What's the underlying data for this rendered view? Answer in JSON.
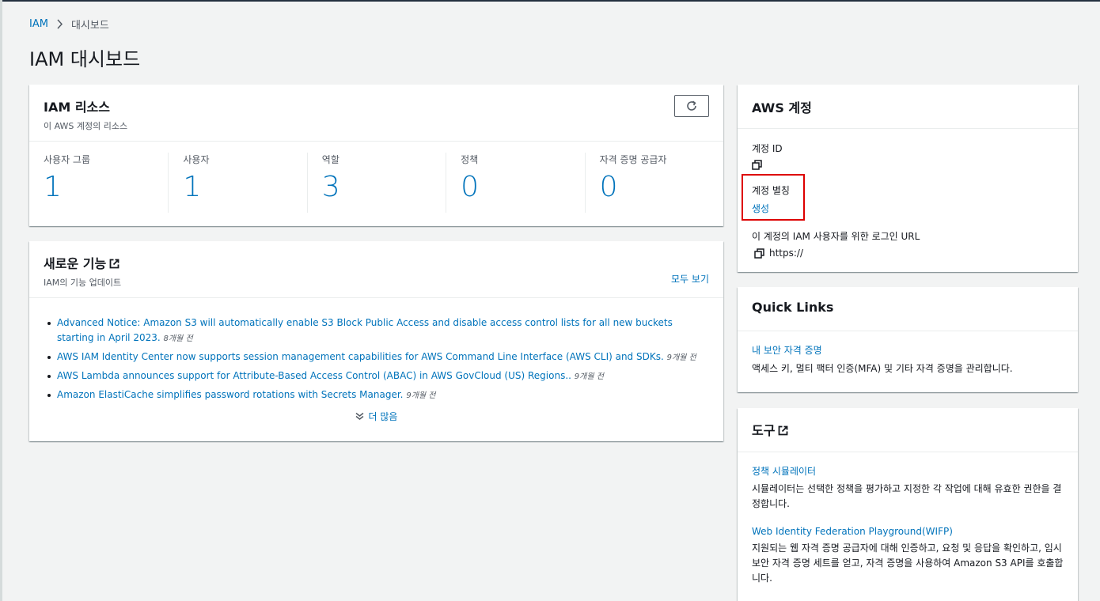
{
  "breadcrumb": {
    "root": "IAM",
    "current": "대시보드"
  },
  "page_title": "IAM 대시보드",
  "resources": {
    "title": "IAM 리소스",
    "subtitle": "이 AWS 계정의 리소스",
    "metrics": [
      {
        "label": "사용자 그룹",
        "value": "1"
      },
      {
        "label": "사용자",
        "value": "1"
      },
      {
        "label": "역할",
        "value": "3"
      },
      {
        "label": "정책",
        "value": "0"
      },
      {
        "label": "자격 증명 공급자",
        "value": "0"
      }
    ]
  },
  "news": {
    "title": "새로운 기능",
    "subtitle": "IAM의 기능 업데이트",
    "see_all": "모두 보기",
    "items": [
      {
        "text": "Advanced Notice: Amazon S3 will automatically enable S3 Block Public Access and disable access control lists for all new buckets starting in April 2023.",
        "ago": "8개월 전"
      },
      {
        "text": "AWS IAM Identity Center now supports session management capabilities for AWS Command Line Interface (AWS CLI) and SDKs.",
        "ago": "9개월 전"
      },
      {
        "text": "AWS Lambda announces support for Attribute-Based Access Control (ABAC) in AWS GovCloud (US) Regions..",
        "ago": "9개월 전"
      },
      {
        "text": "Amazon ElastiCache simplifies password rotations with Secrets Manager.",
        "ago": "9개월 전"
      }
    ],
    "more": "더 많음"
  },
  "account": {
    "title": "AWS 계정",
    "id_label": "계정 ID",
    "alias_label": "계정 별칭",
    "alias_action": "생성",
    "url_label": "이 계정의 IAM 사용자를 위한 로그인 URL",
    "url_value": "https://"
  },
  "quick_links": {
    "title": "Quick Links",
    "link": "내 보안 자격 증명",
    "desc": "액세스 키, 멀티 팩터 인증(MFA) 및 기타 자격 증명을 관리합니다."
  },
  "tools": {
    "title": "도구",
    "items": [
      {
        "link": "정책 시뮬레이터",
        "desc": "시뮬레이터는 선택한 정책을 평가하고 지정한 각 작업에 대해 유효한 권한을 결정합니다."
      },
      {
        "link": "Web Identity Federation Playground(WIFP)",
        "desc": "지원되는 웹 자격 증명 공급자에 대해 인증하고, 요청 및 응답을 확인하고, 임시 보안 자격 증명 세트를 얻고, 자격 증명을 사용하여 Amazon S3 API를 호출합니다."
      }
    ]
  }
}
